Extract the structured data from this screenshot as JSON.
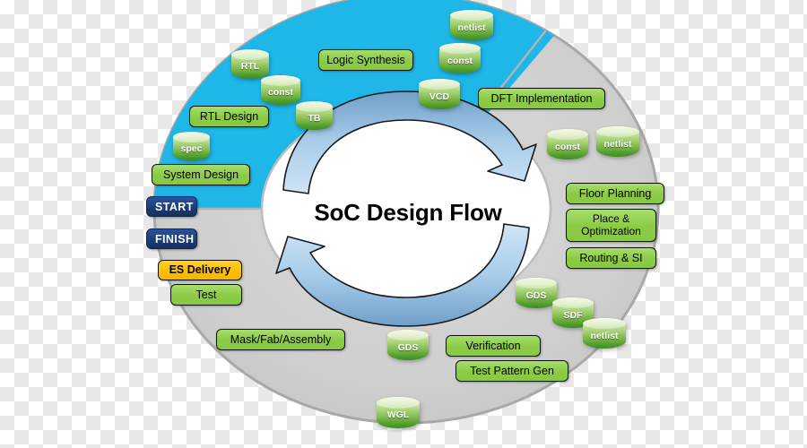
{
  "diagram": {
    "title": "SoC Design Flow",
    "colors": {
      "front_end_sector": "#1fb6e8",
      "back_end_sector": "#cfcfcf",
      "process_box_green": "#92d050",
      "delivery_box_gold": "#ffc000",
      "marker_navy": "#1f3f7a",
      "arrow_blue": "#9dc3e6",
      "outline": "#9a9a9a"
    },
    "markers": [
      {
        "label": "START"
      },
      {
        "label": "FINISH"
      }
    ],
    "process_steps": [
      {
        "label": "System Design"
      },
      {
        "label": "RTL Design"
      },
      {
        "label": "Logic Synthesis"
      },
      {
        "label": "DFT Implementation"
      },
      {
        "label": "Floor Planning"
      },
      {
        "label": "Place & Optimization"
      },
      {
        "label": "Routing & SI"
      },
      {
        "label": "Verification"
      },
      {
        "label": "Test Pattern Gen"
      },
      {
        "label": "Mask/Fab/Assembly"
      },
      {
        "label": "Test"
      },
      {
        "label": "ES Delivery"
      }
    ],
    "data_objects": [
      {
        "label": "spec"
      },
      {
        "label": "RTL"
      },
      {
        "label": "const"
      },
      {
        "label": "TB"
      },
      {
        "label": "netlist"
      },
      {
        "label": "const"
      },
      {
        "label": "VCD"
      },
      {
        "label": "const"
      },
      {
        "label": "netlist"
      },
      {
        "label": "GDS"
      },
      {
        "label": "SDF"
      },
      {
        "label": "netlist"
      },
      {
        "label": "GDS"
      },
      {
        "label": "WGL"
      }
    ]
  }
}
